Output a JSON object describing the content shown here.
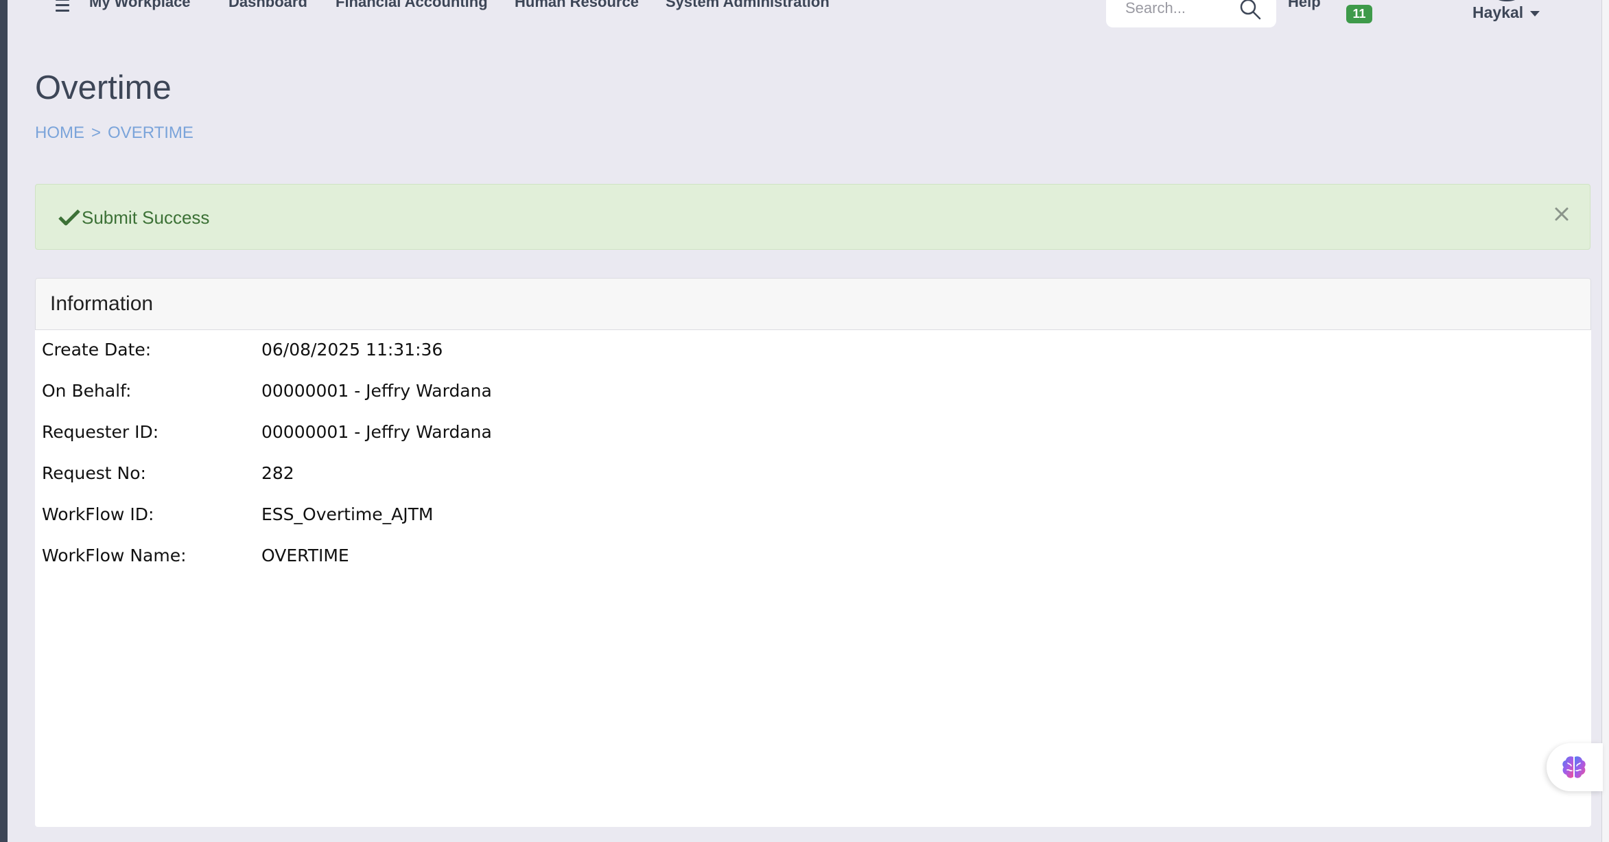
{
  "nav": {
    "items": [
      "My Workplace",
      "Dashboard",
      "Financial Accounting",
      "Human Resource",
      "System Administration"
    ],
    "search_placeholder": "Search...",
    "help_label": "Help",
    "notification_count": "11",
    "user_name": "Haykal"
  },
  "page": {
    "title": "Overtime",
    "breadcrumb": [
      "HOME",
      ">",
      "OVERTIME"
    ]
  },
  "alert": {
    "message": "Submit Success",
    "color": "#e1efd9",
    "text_color": "#3c7136"
  },
  "information": {
    "header": "Information",
    "rows": [
      {
        "label": "Create Date:",
        "value": "06/08/2025 11:31:36"
      },
      {
        "label": "On Behalf:",
        "value": "00000001 - Jeffry Wardana"
      },
      {
        "label": "Requester ID:",
        "value": "00000001 - Jeffry Wardana"
      },
      {
        "label": "Request No:",
        "value": "282"
      },
      {
        "label": "WorkFlow ID:",
        "value": "ESS_Overtime_AJTM"
      },
      {
        "label": "WorkFlow Name:",
        "value": "OVERTIME"
      }
    ]
  },
  "icons": {
    "menu": "hamburger-icon",
    "search": "search-icon",
    "success": "checkmark-icon",
    "close": "close-icon",
    "assistant": "brain-icon"
  },
  "colors": {
    "background": "#eae9f1",
    "nav_text": "#3d4657",
    "link": "#7ba4da",
    "badge": "#3e9a4a"
  }
}
